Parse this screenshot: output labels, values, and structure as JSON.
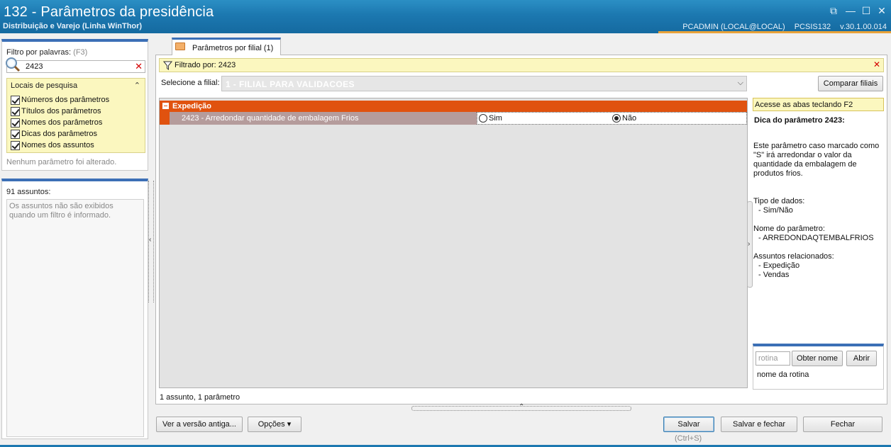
{
  "window": {
    "title": "132 - Parâmetros da presidência",
    "subtitle": "Distribuição e Varejo (Linha WinThor)",
    "user": "PCADMIN (LOCAL@LOCAL)",
    "module": "PCSIS132",
    "version": "v.30.1.00.014",
    "controls": {
      "restore": "⧉",
      "minimize": "—",
      "maximize": "☐",
      "close": "✕"
    }
  },
  "left": {
    "filter_label": "Filtro por palavras:",
    "filter_key": "(F3)",
    "search_value": "2423",
    "locais_title": "Locais de pesquisa",
    "locais_items": [
      "Números dos parâmetros",
      "Títulos dos parâmetros",
      "Nomes dos parâmetros",
      "Dicas dos parâmetros",
      "Nomes dos assuntos"
    ],
    "no_change": "Nenhum parâmetro foi alterado.",
    "subjects_count": "91 assuntos:",
    "subjects_info": "Os assuntos não são exibidos quando um filtro é informado."
  },
  "main": {
    "tab_label": "Parâmetros por filial  (1)",
    "filter_text": "Filtrado por: 2423",
    "select_label": "Selecione a filial:",
    "select_value": "1 - FILIAL PARA VALIDACOES",
    "compare_button": "Comparar filiais",
    "group_name": "Expedição",
    "param_name": "2423 - Arredondar quantidade de embalagem Frios",
    "option_yes": "Sim",
    "option_no": "Não",
    "status": "1 assunto, 1 parâmetro"
  },
  "right": {
    "hint": "Acesse as abas teclando F2",
    "tip_title": "Dica do parâmetro 2423:",
    "tip_body": "Este parâmetro caso marcado como \"S\" irá arredondar o valor da quantidade da embalagem de produtos frios.",
    "data_type_label": "Tipo de dados:",
    "data_type_value": "- Sim/Não",
    "param_name_label": "Nome do parâmetro:",
    "param_name_value": "- ARREDONDAQTEMBALFRIOS",
    "related_label": "Assuntos relacionados:",
    "related_1": "- Expedição",
    "related_2": "- Vendas",
    "rotina_placeholder": "rotina",
    "obter_button": "Obter nome",
    "abrir_button": "Abrir",
    "rotina_desc": "nome da rotina"
  },
  "footer": {
    "old_version_button": "Ver a versão antiga...",
    "options_button": "Opções ▾",
    "save_button": "Salvar",
    "save_hotkey": "(Ctrl+S)",
    "save_close_button": "Salvar e fechar",
    "close_button": "Fechar"
  }
}
